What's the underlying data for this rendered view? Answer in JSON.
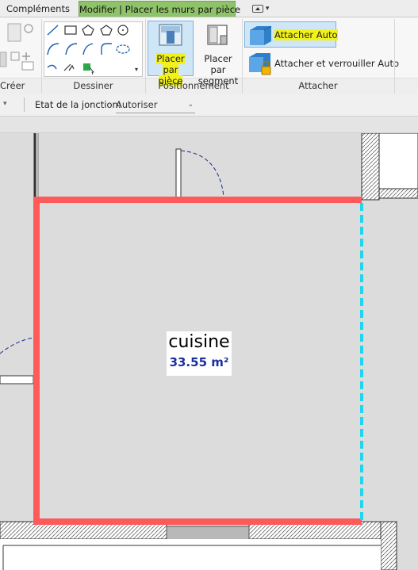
{
  "tabs": {
    "complements": "Compléments",
    "active": "Modifier | Placer les murs par pièce"
  },
  "ribbon": {
    "creer_label": "Créer",
    "dessiner_label": "Dessiner",
    "positionnement_label": "Positionnement",
    "attacher_label": "Attacher",
    "placer_piece": {
      "line1": "Placer par",
      "line2": "pièce"
    },
    "placer_segment": {
      "line1": "Placer par",
      "line2": "segment"
    },
    "attacher_auto": "Attacher Auto",
    "attacher_verrouiller": "Attacher et verrouiller Auto"
  },
  "options": {
    "jonction_label": "Etat de la jonction:",
    "jonction_value": "Autoriser"
  },
  "room": {
    "name": "cuisine",
    "area": "33.55 m²"
  },
  "colors": {
    "active_tab": "#8fc36a",
    "highlight": "#f2f21a",
    "room_boundary": "#ff5a5a",
    "open_side": "#1fd6ee",
    "area_text": "#1a2fa0"
  }
}
